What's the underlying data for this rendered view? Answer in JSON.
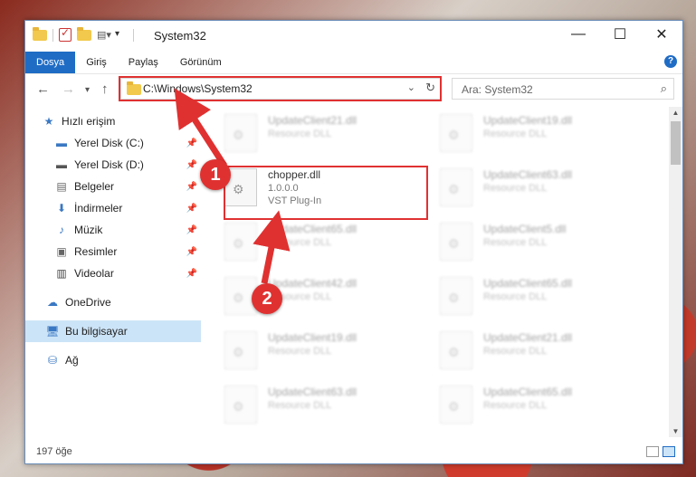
{
  "window": {
    "title": "System32"
  },
  "ribbon": {
    "tabs": [
      "Dosya",
      "Giriş",
      "Paylaş",
      "Görünüm"
    ]
  },
  "address": {
    "path": "C:\\Windows\\System32"
  },
  "search": {
    "placeholder": "Ara: System32"
  },
  "sidebar": {
    "items": [
      {
        "label": "Hızlı erişim",
        "icon": "star-icon"
      },
      {
        "label": "Yerel Disk (C:)",
        "icon": "drive-icon"
      },
      {
        "label": "Yerel Disk (D:)",
        "icon": "drive-icon"
      },
      {
        "label": "Belgeler",
        "icon": "document-icon"
      },
      {
        "label": "İndirmeler",
        "icon": "download-icon"
      },
      {
        "label": "Müzik",
        "icon": "music-icon"
      },
      {
        "label": "Resimler",
        "icon": "picture-icon"
      },
      {
        "label": "Videolar",
        "icon": "video-icon"
      },
      {
        "label": "OneDrive",
        "icon": "cloud-icon"
      },
      {
        "label": "Bu bilgisayar",
        "icon": "computer-icon"
      },
      {
        "label": "Ağ",
        "icon": "network-icon"
      }
    ]
  },
  "files": [
    {
      "name": "UpdateClient21.dll",
      "line1": "Resource DLL",
      "line2": ""
    },
    {
      "name": "UpdateClient19.dll",
      "line1": "Resource DLL",
      "line2": ""
    },
    {
      "name": "chopper.dll",
      "line1": "1.0.0.0",
      "line2": "VST Plug-In"
    },
    {
      "name": "UpdateClient63.dll",
      "line1": "Resource DLL",
      "line2": ""
    },
    {
      "name": "UpdateClient65.dll",
      "line1": "Resource DLL",
      "line2": ""
    },
    {
      "name": "UpdateClient5.dll",
      "line1": "Resource DLL",
      "line2": ""
    },
    {
      "name": "UpdateClient42.dll",
      "line1": "Resource DLL",
      "line2": ""
    },
    {
      "name": "UpdateClient65.dll",
      "line1": "Resource DLL",
      "line2": ""
    },
    {
      "name": "UpdateClient19.dll",
      "line1": "Resource DLL",
      "line2": ""
    },
    {
      "name": "UpdateClient21.dll",
      "line1": "Resource DLL",
      "line2": ""
    },
    {
      "name": "UpdateClient63.dll",
      "line1": "Resource DLL",
      "line2": ""
    },
    {
      "name": "UpdateClient65.dll",
      "line1": "Resource DLL",
      "line2": ""
    }
  ],
  "markers": {
    "one": "1",
    "two": "2"
  },
  "status": {
    "count": "197 öğe"
  },
  "colors": {
    "accent": "#1f6cc5",
    "highlight": "#e03131",
    "selection": "#cce4f7"
  }
}
